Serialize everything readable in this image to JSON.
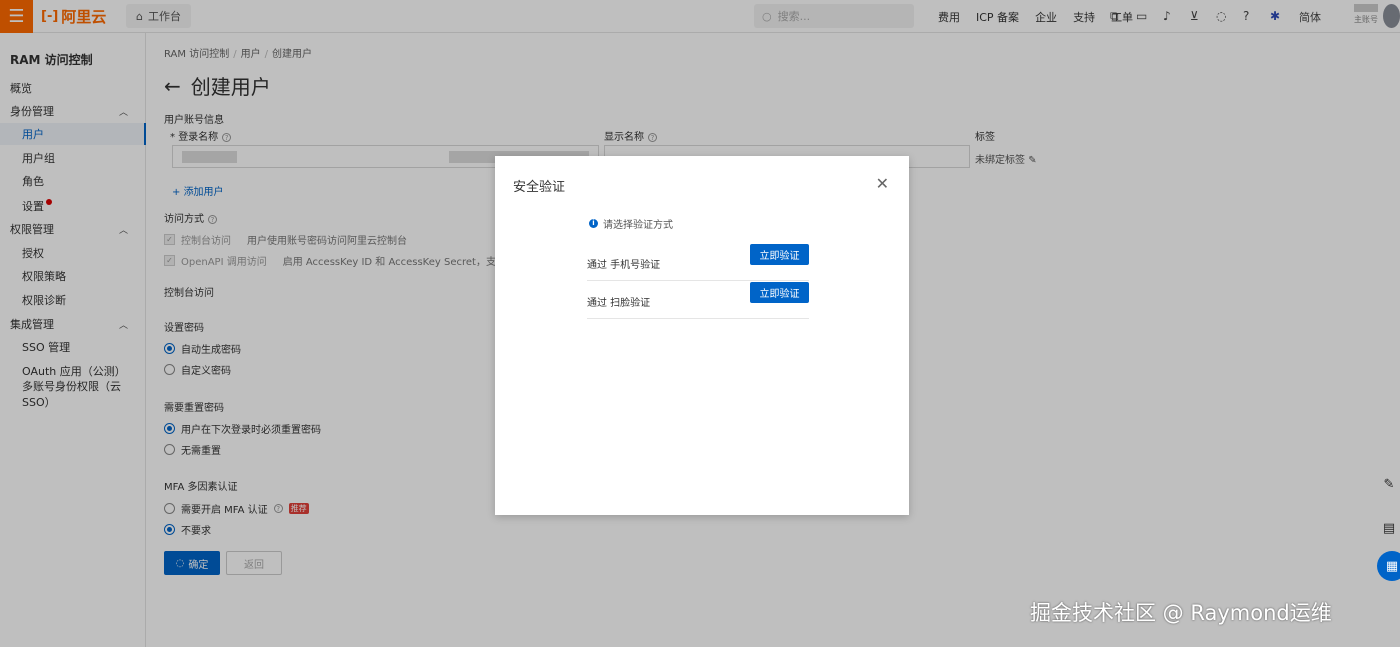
{
  "topbar": {
    "brand": "阿里云",
    "workbench": "工作台",
    "search_placeholder": "搜索...",
    "nav": [
      "费用",
      "ICP 备案",
      "企业",
      "支持",
      "工单"
    ],
    "language": "简体",
    "account_sub": "主账号"
  },
  "sidebar": {
    "title": "RAM 访问控制",
    "overview": "概览",
    "groups": [
      {
        "label": "身份管理",
        "items": [
          "用户",
          "用户组",
          "角色",
          "设置"
        ]
      },
      {
        "label": "权限管理",
        "items": [
          "授权",
          "权限策略",
          "权限诊断"
        ]
      },
      {
        "label": "集成管理",
        "items": [
          "SSO 管理",
          "OAuth 应用（公测）",
          "多账号身份权限（云 SSO）"
        ]
      }
    ]
  },
  "breadcrumb": [
    "RAM 访问控制",
    "用户",
    "创建用户"
  ],
  "page_title": "创建用户",
  "form": {
    "section_account": "用户账号信息",
    "login_name_label": "登录名称",
    "display_name_label": "显示名称",
    "tags_label": "标签",
    "tags_value": "未绑定标签",
    "add_user": "添加用户",
    "access_label": "访问方式",
    "console_access": "控制台访问",
    "console_access_desc": "用户使用账号密码访问阿里云控制台",
    "openapi_access": "OpenAPI 调用访问",
    "openapi_access_desc": "启用 AccessKey ID 和 AccessKey Secret，支持通过 API 或其",
    "console_section": "控制台访问",
    "password_label": "设置密码",
    "password_auto": "自动生成密码",
    "password_custom": "自定义密码",
    "reset_label": "需要重置密码",
    "reset_required": "用户在下次登录时必须重置密码",
    "reset_none": "无需重置",
    "mfa_label": "MFA 多因素认证",
    "mfa_required": "需要开启 MFA 认证",
    "mfa_badge": "推荐",
    "mfa_none": "不要求",
    "confirm": "确定",
    "back": "返回"
  },
  "dialog": {
    "title": "安全验证",
    "hint": "请选择验证方式",
    "options": [
      {
        "label": "通过 手机号验证",
        "button": "立即验证"
      },
      {
        "label": "通过 扫脸验证",
        "button": "立即验证"
      }
    ]
  },
  "watermark": "掘金技术社区 @ Raymond运维",
  "colors": {
    "brand": "#ff6a00",
    "primary": "#0064c8"
  }
}
